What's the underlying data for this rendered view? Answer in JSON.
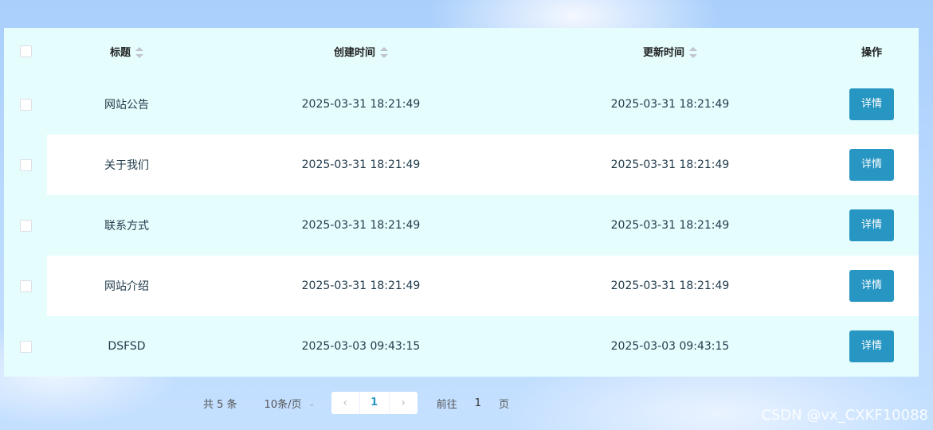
{
  "table": {
    "headers": {
      "title": "标题",
      "created": "创建时间",
      "updated": "更新时间",
      "action": "操作"
    },
    "rows": [
      {
        "title": "网站公告",
        "created": "2025-03-31 18:21:49",
        "updated": "2025-03-31 18:21:49",
        "action": "详情"
      },
      {
        "title": "关于我们",
        "created": "2025-03-31 18:21:49",
        "updated": "2025-03-31 18:21:49",
        "action": "详情"
      },
      {
        "title": "联系方式",
        "created": "2025-03-31 18:21:49",
        "updated": "2025-03-31 18:21:49",
        "action": "详情"
      },
      {
        "title": "网站介绍",
        "created": "2025-03-31 18:21:49",
        "updated": "2025-03-31 18:21:49",
        "action": "详情"
      },
      {
        "title": "DSFSD",
        "created": "2025-03-03 09:43:15",
        "updated": "2025-03-03 09:43:15",
        "action": "详情"
      }
    ]
  },
  "pagination": {
    "total": "共 5 条",
    "page_size": "10条/页",
    "prev_icon": "‹",
    "current_page": "1",
    "next_icon": "›",
    "goto_label": "前往",
    "goto_value": "1",
    "page_suffix": "页"
  },
  "watermark": "CSDN @vx_CXKF10088",
  "colors": {
    "table_bg": "#e6fdfd",
    "button": "#2896c3"
  }
}
